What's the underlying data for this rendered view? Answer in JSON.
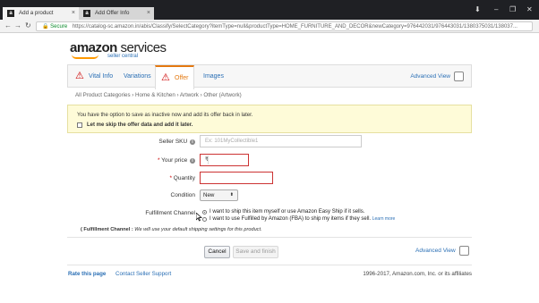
{
  "browser": {
    "tabs": [
      {
        "label": "Add a product",
        "favicon": "a"
      },
      {
        "label": "Add Offer Info",
        "favicon": "a"
      }
    ],
    "secure_label": "Secure",
    "url": "https://catalog-sc.amazon.in/abis/Classify/SelectCategory?itemType=null&productType=HOME_FURNITURE_AND_DECOR&newCategory=976442031/976443031/1380375031/138037..."
  },
  "logo": {
    "brand_bold": "amazon",
    "brand_light": " services",
    "sub": "seller central"
  },
  "product_tabs": [
    {
      "label": "Vital Info",
      "warning": true
    },
    {
      "label": "Variations",
      "warning": false
    },
    {
      "label": "Offer",
      "warning": true,
      "active": true
    },
    {
      "label": "Images",
      "warning": false
    }
  ],
  "advanced_view": "Advanced View",
  "breadcrumb": "All Product Categories › Home & Kitchen › Artwork › Other (Artwork)",
  "notice": {
    "message": "You have the option to save as inactive now and add its offer back in later.",
    "checkbox_label": "Let me skip the offer data and add it later."
  },
  "form": {
    "seller_sku_label": "Seller SKU",
    "seller_sku_placeholder": "Ex: 101MyCollectible1",
    "your_price_label": "Your price",
    "currency_symbol": "₹",
    "quantity_label": "Quantity",
    "condition_label": "Condition",
    "condition_value": "New",
    "fulfillment_label": "Fulfillment Channel",
    "fulfillment_option_1": "I want to ship this item myself or use Amazon Easy Ship if it sells.",
    "fulfillment_option_2": "I want to use Fulfilled by Amazon (FBA) to ship my items if they sell.",
    "learn_more": "Learn more",
    "fulfillment_note_bold": "( Fulfillment Channel :",
    "fulfillment_note": " We will use your default shipping settings for this product."
  },
  "buttons": {
    "cancel": "Cancel",
    "save": "Save and finish"
  },
  "footer": {
    "rate": "Rate this page",
    "contact": "Contact Seller Support",
    "copyright": "1996-2017, Amazon.com, Inc. or its affiliates"
  },
  "colors": {
    "accent": "#e47911",
    "link": "#2a6fb5",
    "error": "#cc3333"
  }
}
